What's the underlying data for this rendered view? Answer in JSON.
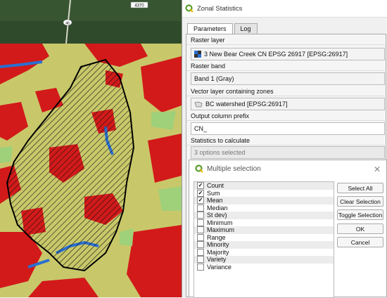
{
  "map": {
    "road_label": "4370",
    "route_label": "46"
  },
  "dialog": {
    "title": "Zonal Statistics",
    "tabs": [
      {
        "label": "Parameters"
      },
      {
        "label": "Log"
      }
    ],
    "raster_layer_label": "Raster layer",
    "raster_layer_value": "3 New Bear Creek CN EPSG 26917 [EPSG:26917]",
    "raster_band_label": "Raster band",
    "raster_band_value": "Band 1 (Gray)",
    "vector_layer_label": "Vector layer containing zones",
    "vector_layer_value": "BC watershed [EPSG:26917]",
    "prefix_label": "Output column prefix",
    "prefix_value": "CN_",
    "stats_label": "Statistics to calculate",
    "stats_value": "3 options selected"
  },
  "multiple_selection": {
    "title": "Multiple selection",
    "options": [
      {
        "label": "Count",
        "checked": true
      },
      {
        "label": "Sum",
        "checked": true
      },
      {
        "label": "Mean",
        "checked": true
      },
      {
        "label": "Median",
        "checked": false
      },
      {
        "label": "St dev)",
        "checked": false
      },
      {
        "label": "Minimum",
        "checked": false
      },
      {
        "label": "Maximum",
        "checked": false
      },
      {
        "label": "Range",
        "checked": false
      },
      {
        "label": "Minority",
        "checked": false
      },
      {
        "label": "Majority",
        "checked": false
      },
      {
        "label": "Variety",
        "checked": false
      },
      {
        "label": "Variance",
        "checked": false
      }
    ],
    "buttons": {
      "select_all": "Select All",
      "clear_selection": "Clear Selection",
      "toggle_selection": "Toggle Selection",
      "ok": "OK",
      "cancel": "Cancel"
    }
  },
  "colors": {
    "accent_green": "#5a9e2d",
    "map_red": "#d21a1a",
    "map_blue": "#2a6fd0",
    "map_olive": "#c8c86a"
  }
}
